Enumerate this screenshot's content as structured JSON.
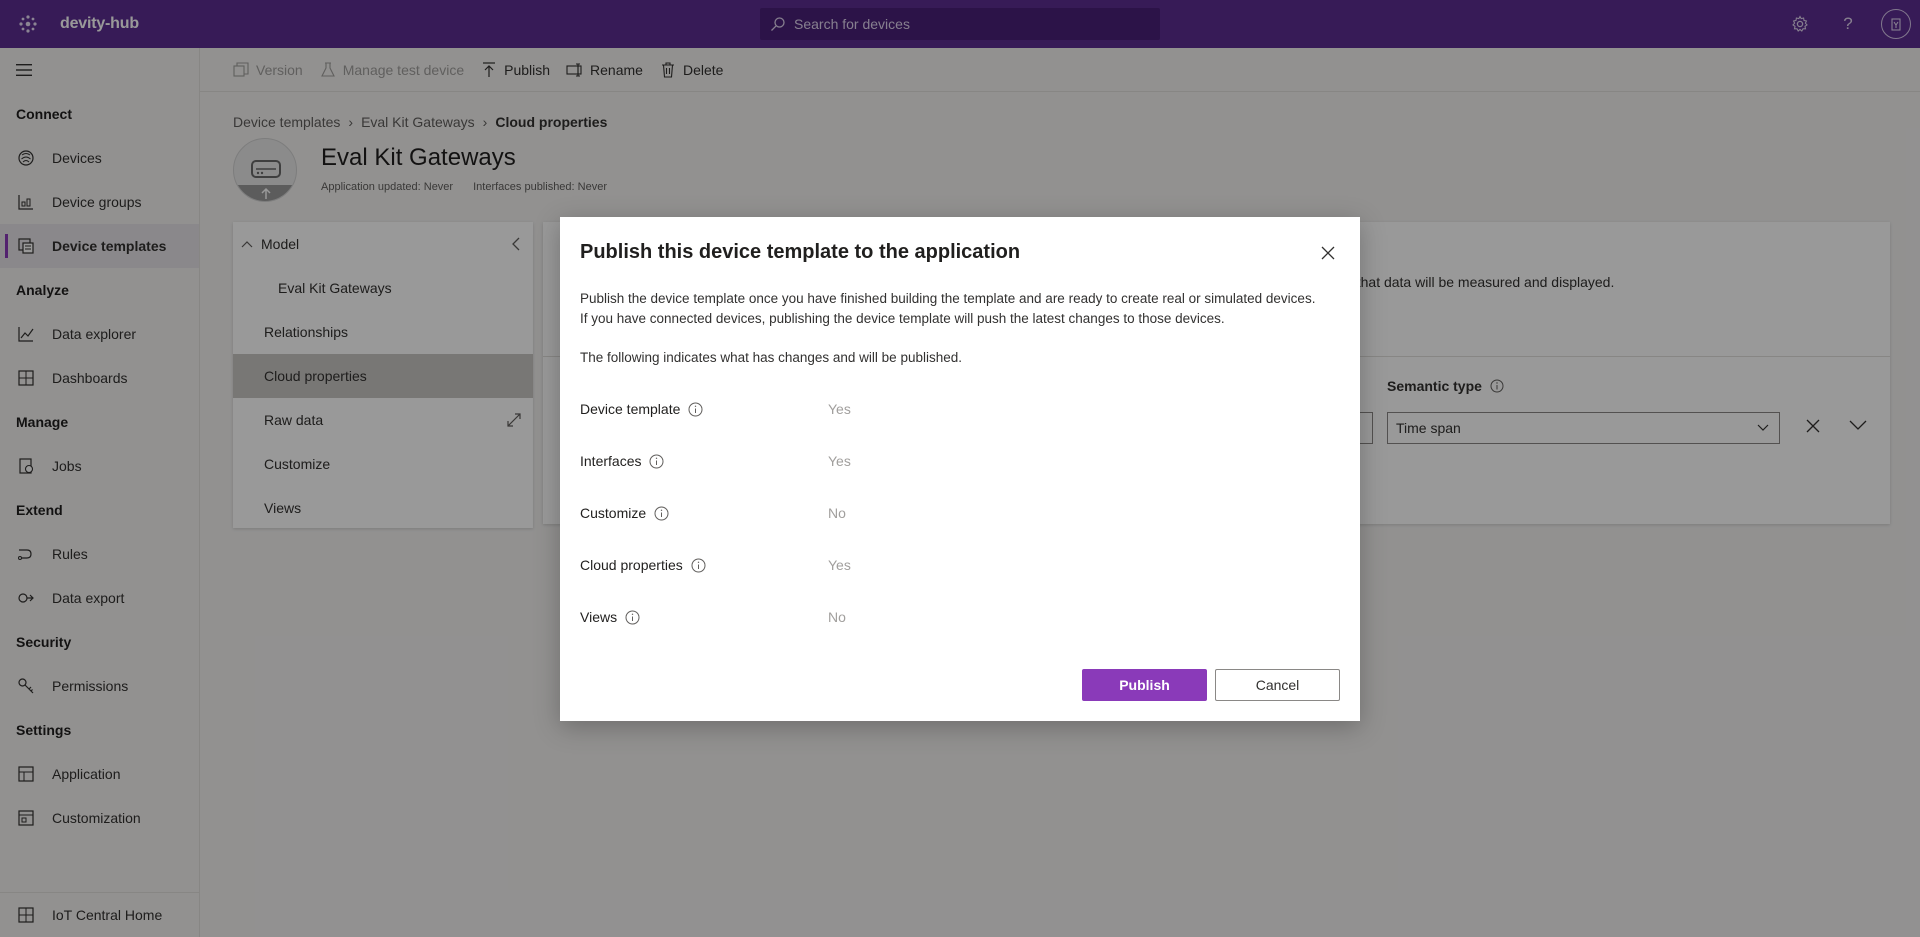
{
  "app": {
    "name": "devity-hub"
  },
  "search": {
    "placeholder": "Search for devices"
  },
  "topbar": {
    "icons": [
      "settings-icon",
      "help-icon",
      "account-icon"
    ]
  },
  "sidebar": {
    "sections": [
      {
        "title": "Connect",
        "items": [
          {
            "label": "Devices",
            "icon": "devices-icon"
          },
          {
            "label": "Device groups",
            "icon": "device-groups-icon"
          },
          {
            "label": "Device templates",
            "icon": "device-templates-icon",
            "active": true
          }
        ]
      },
      {
        "title": "Analyze",
        "items": [
          {
            "label": "Data explorer",
            "icon": "data-explorer-icon"
          },
          {
            "label": "Dashboards",
            "icon": "dashboards-icon"
          }
        ]
      },
      {
        "title": "Manage",
        "items": [
          {
            "label": "Jobs",
            "icon": "jobs-icon"
          }
        ]
      },
      {
        "title": "Extend",
        "items": [
          {
            "label": "Rules",
            "icon": "rules-icon"
          },
          {
            "label": "Data export",
            "icon": "data-export-icon"
          }
        ]
      },
      {
        "title": "Security",
        "items": [
          {
            "label": "Permissions",
            "icon": "permissions-icon"
          }
        ]
      },
      {
        "title": "Settings",
        "items": [
          {
            "label": "Application",
            "icon": "application-icon"
          },
          {
            "label": "Customization",
            "icon": "customization-icon"
          }
        ]
      }
    ],
    "bottom_item": {
      "label": "IoT Central Home",
      "icon": "home-icon"
    }
  },
  "toolbar": {
    "version": "Version",
    "manage_test_device": "Manage test device",
    "publish": "Publish",
    "rename": "Rename",
    "delete": "Delete"
  },
  "breadcrumb": [
    "Device templates",
    "Eval Kit Gateways",
    "Cloud properties"
  ],
  "header": {
    "title": "Eval Kit Gateways",
    "app_updated": "Application updated: Never",
    "interfaces_published": "Interfaces published: Never"
  },
  "tree": {
    "model": "Model",
    "model_child": "Eval Kit Gateways",
    "relationships": "Relationships",
    "cloud_properties": "Cloud properties",
    "raw_data": "Raw data",
    "customize": "Customize",
    "views": "Views"
  },
  "background_card": {
    "hint_text": "vice will collect. Then choose how that data will be measured and displayed.",
    "semantic_type_label": "Semantic type",
    "semantic_type_value": "Time span"
  },
  "dialog": {
    "title": "Publish this device template to the application",
    "desc_line1": "Publish the device template once you have finished building the template and are ready to create real or simulated devices.",
    "desc_line2": "If you have connected devices, publishing the device template will push the latest changes to those devices.",
    "note": "The following indicates what has changes and will be published.",
    "rows": [
      {
        "label": "Device template",
        "value": "Yes"
      },
      {
        "label": "Interfaces",
        "value": "Yes"
      },
      {
        "label": "Customize",
        "value": "No"
      },
      {
        "label": "Cloud properties",
        "value": "Yes"
      },
      {
        "label": "Views",
        "value": "No"
      }
    ],
    "publish_label": "Publish",
    "cancel_label": "Cancel"
  },
  "colors": {
    "brand": "#5c2d91",
    "accent": "#8a3ab9"
  }
}
